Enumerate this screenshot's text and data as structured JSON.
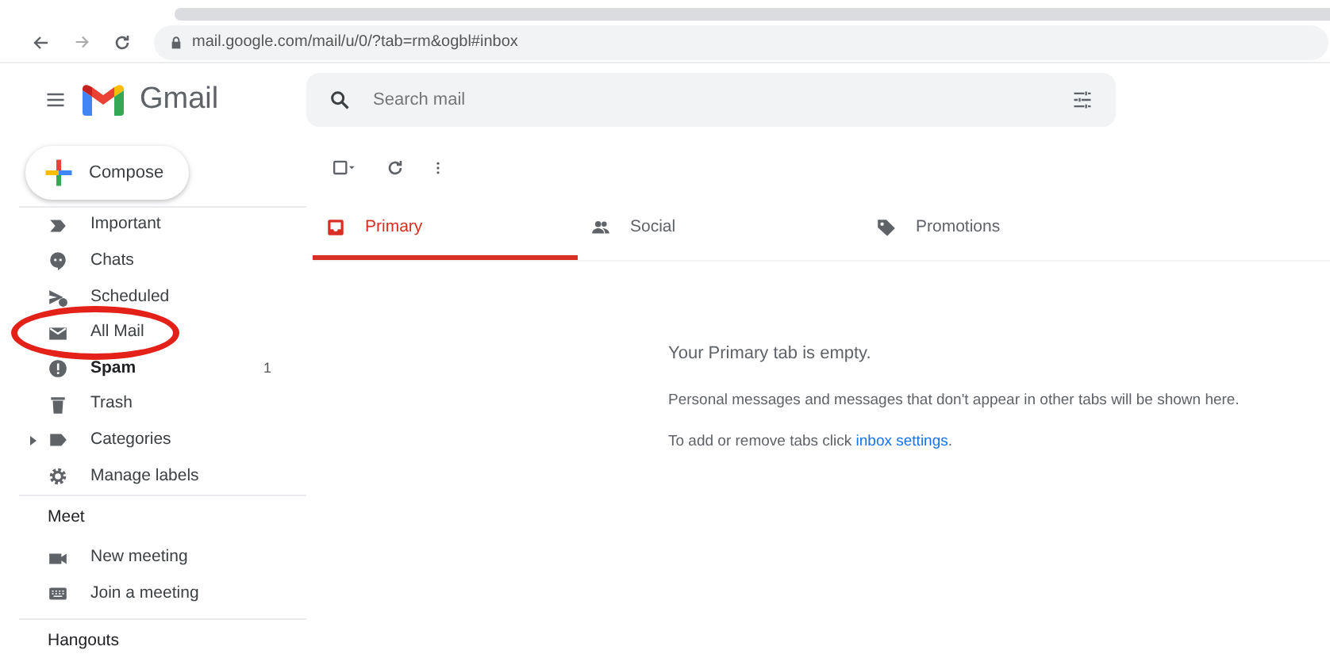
{
  "browser": {
    "url": "mail.google.com/mail/u/0/?tab=rm&ogbl#inbox"
  },
  "header": {
    "app_name": "Gmail",
    "search": {
      "placeholder": "Search mail"
    }
  },
  "compose": {
    "label": "Compose"
  },
  "sidebar": {
    "items": [
      {
        "kind": "important",
        "label": "Important",
        "unread": false,
        "expandable": false,
        "circled": false
      },
      {
        "kind": "chats",
        "label": "Chats",
        "unread": false,
        "expandable": false,
        "circled": false
      },
      {
        "kind": "scheduled",
        "label": "Scheduled",
        "unread": false,
        "expandable": false,
        "circled": false
      },
      {
        "kind": "allmail",
        "label": "All Mail",
        "unread": false,
        "expandable": false,
        "circled": true
      },
      {
        "kind": "spam",
        "label": "Spam",
        "unread": true,
        "count": "1",
        "expandable": false,
        "circled": false
      },
      {
        "kind": "trash",
        "label": "Trash",
        "unread": false,
        "expandable": false,
        "circled": false
      },
      {
        "kind": "label",
        "label": "Categories",
        "unread": false,
        "expandable": true,
        "circled": false
      },
      {
        "kind": "gear",
        "label": "Manage labels",
        "unread": false,
        "expandable": false,
        "circled": false
      }
    ],
    "meet": {
      "heading": "Meet",
      "items": [
        {
          "kind": "video",
          "label": "New meeting"
        },
        {
          "kind": "keyboard",
          "label": "Join a meeting"
        }
      ]
    },
    "hangouts": {
      "heading": "Hangouts"
    }
  },
  "tabs": [
    {
      "kind": "inbox",
      "label": "Primary",
      "selected": true
    },
    {
      "kind": "people",
      "label": "Social",
      "selected": false
    },
    {
      "kind": "tag",
      "label": "Promotions",
      "selected": false
    }
  ],
  "empty": {
    "title": "Your Primary tab is empty.",
    "body": "Personal messages and messages that don't appear in other tabs will be shown here.",
    "settings_text": "To add or remove tabs click ",
    "settings_link": "inbox settings",
    "settings_end": "."
  }
}
